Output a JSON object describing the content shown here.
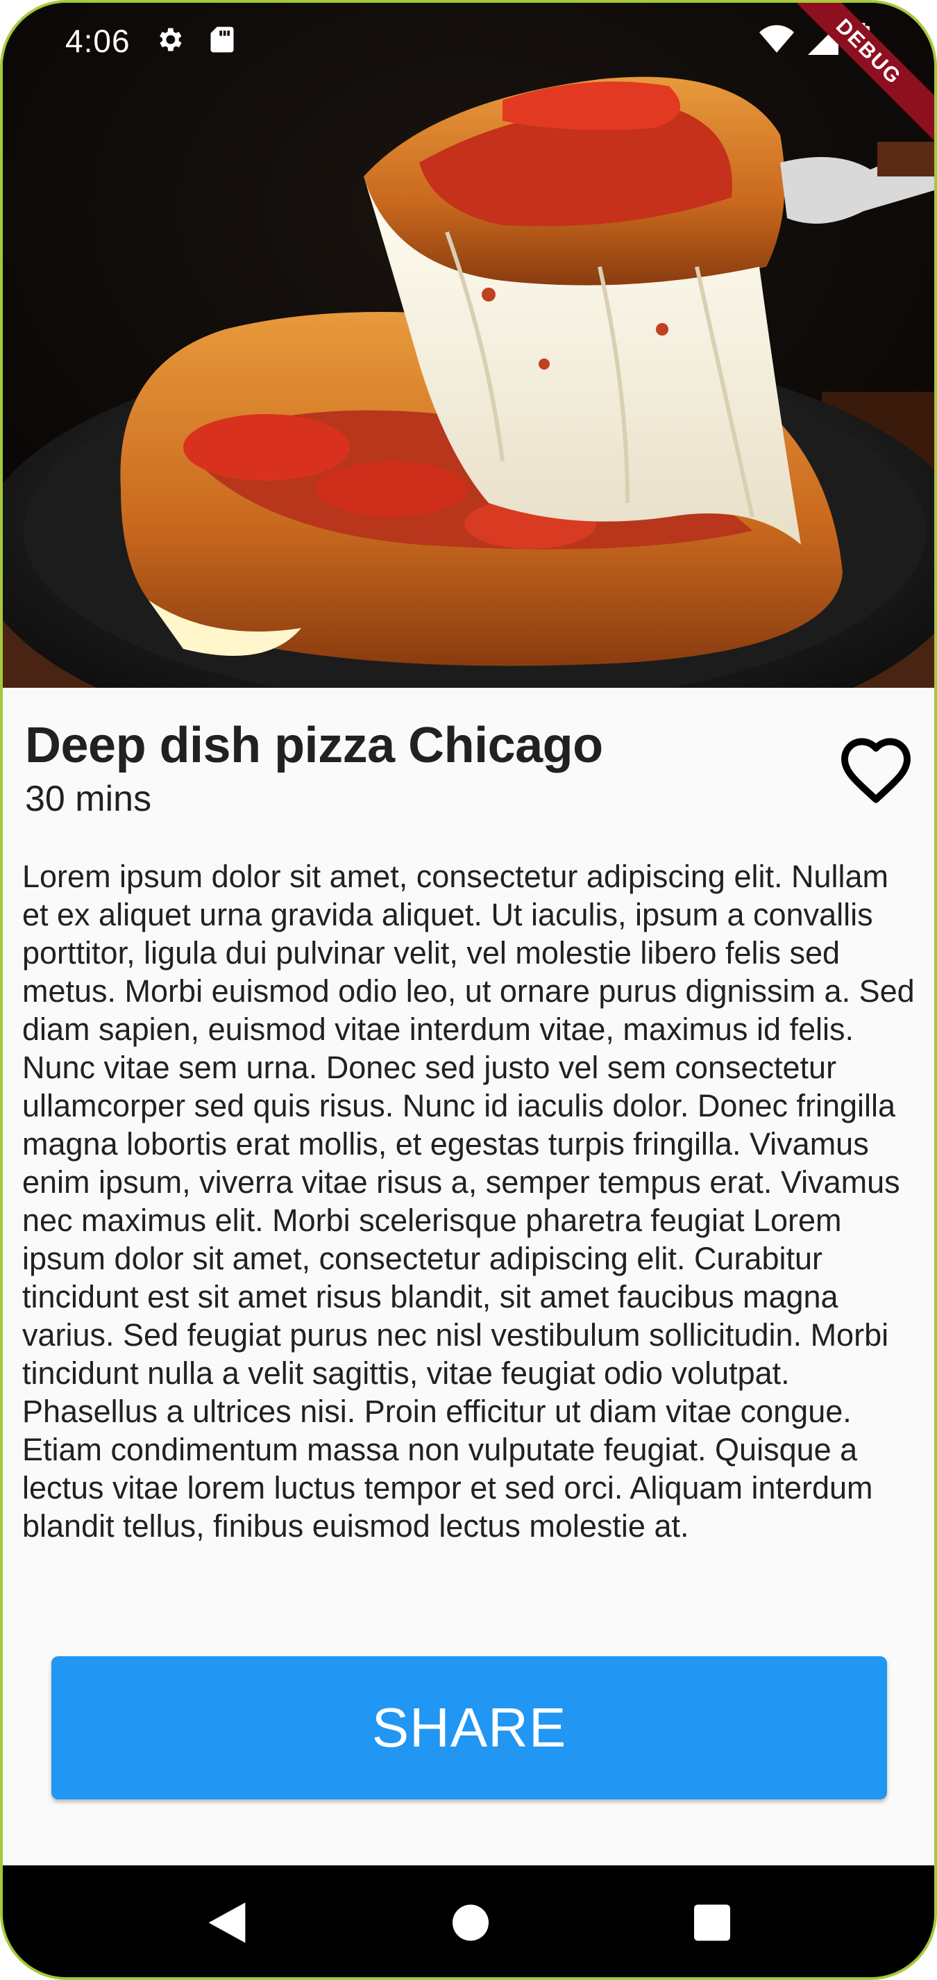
{
  "status_bar": {
    "time": "4:06",
    "icons": [
      "gear-icon",
      "sd-card-icon",
      "wifi-icon",
      "signal-icon",
      "battery-icon"
    ]
  },
  "debug_banner": "DEBUG",
  "recipe": {
    "title": "Deep dish pizza Chicago",
    "duration": "30 mins",
    "favorite_icon": "heart-outline-icon",
    "description": "Lorem ipsum dolor sit amet, consectetur adipiscing elit. Nullam et ex aliquet urna gravida aliquet. Ut iaculis, ipsum a convallis porttitor, ligula dui pulvinar velit, vel molestie libero felis sed metus. Morbi euismod odio leo, ut ornare purus dignissim a. Sed diam sapien, euismod vitae interdum vitae, maximus id felis. Nunc vitae sem urna. Donec sed justo vel sem consectetur ullamcorper sed quis risus. Nunc id iaculis dolor. Donec fringilla magna lobortis erat mollis, et egestas turpis fringilla. Vivamus enim ipsum, viverra vitae risus a, semper tempus erat. Vivamus nec maximus elit. Morbi scelerisque pharetra feugiat Lorem ipsum dolor sit amet, consectetur adipiscing elit. Curabitur tincidunt est sit amet risus blandit, sit amet faucibus magna varius. Sed feugiat purus nec nisl vestibulum sollicitudin. Morbi tincidunt nulla a velit sagittis, vitae feugiat odio volutpat. Phasellus a ultrices nisi. Proin efficitur ut diam vitae congue. Etiam condimentum massa non vulputate feugiat. Quisque a lectus vitae lorem luctus tempor et sed orci. Aliquam interdum blandit tellus, finibus euismod lectus molestie at."
  },
  "share_button": {
    "label": "SHARE",
    "color": "#2196f3"
  },
  "nav_bar": {
    "buttons": [
      "back-icon",
      "home-icon",
      "recents-icon"
    ]
  }
}
